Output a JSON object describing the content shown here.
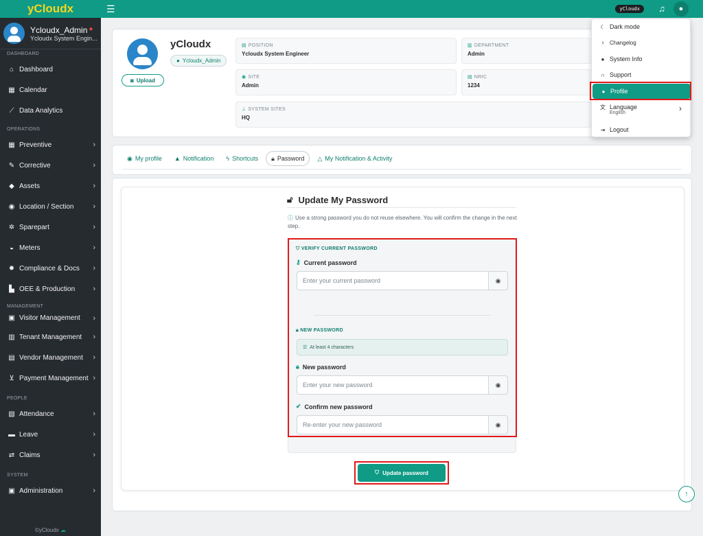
{
  "brand": "yCloudx",
  "user": {
    "name": "Ycloudx_Admin",
    "role": "Ycloudx System Engin..."
  },
  "sidebar": {
    "sections": [
      {
        "label": "DASHBOARD",
        "items": [
          {
            "label": "Dashboard",
            "icon": "home-icon"
          },
          {
            "label": "Calendar",
            "icon": "calendar-icon"
          },
          {
            "label": "Data Analytics",
            "icon": "chart-line-icon"
          }
        ]
      },
      {
        "label": "OPERATIONS",
        "items": [
          {
            "label": "Preventive",
            "icon": "calendar-check-icon"
          },
          {
            "label": "Corrective",
            "icon": "wrench-icon"
          },
          {
            "label": "Assets",
            "icon": "tag-icon"
          },
          {
            "label": "Location / Section",
            "icon": "location-icon"
          },
          {
            "label": "Sparepart",
            "icon": "cogs-icon"
          },
          {
            "label": "Meters",
            "icon": "gauge-icon"
          },
          {
            "label": "Compliance & Docs",
            "icon": "certificate-icon"
          },
          {
            "label": "OEE & Production",
            "icon": "industry-icon"
          }
        ]
      },
      {
        "label": "MANAGEMENT",
        "items": [
          {
            "label": "Visitor Management",
            "icon": "id-badge-icon"
          },
          {
            "label": "Tenant Management",
            "icon": "building-icon"
          },
          {
            "label": "Vendor Management",
            "icon": "id-card-icon"
          },
          {
            "label": "Payment Management",
            "icon": "cart-icon"
          }
        ]
      },
      {
        "label": "PEOPLE",
        "items": [
          {
            "label": "Attendance",
            "icon": "clipboard-icon"
          },
          {
            "label": "Leave",
            "icon": "briefcase-icon"
          },
          {
            "label": "Claims",
            "icon": "exchange-icon"
          }
        ]
      },
      {
        "label": "SYSTEM",
        "items": [
          {
            "label": "Administration",
            "icon": "user-shield-icon"
          }
        ]
      }
    ],
    "footer": "©yCloudx"
  },
  "topbar": {
    "badge": "yCloudx"
  },
  "profile": {
    "name": "yCloudx",
    "username": "Ycloudx_Admin",
    "upload_label": "Upload",
    "fields": [
      {
        "label": "POSITION",
        "value": "Ycloudx System Engineer"
      },
      {
        "label": "DEPARTMENT",
        "value": "Admin"
      },
      {
        "label": "SITE",
        "value": "Admin"
      },
      {
        "label": "NRIC",
        "value": "1234"
      },
      {
        "label": "SYSTEM SITES",
        "value": "HQ"
      }
    ]
  },
  "tabs": [
    {
      "label": "My profile",
      "active": false
    },
    {
      "label": "Notification",
      "active": false
    },
    {
      "label": "Shortcuts",
      "active": false
    },
    {
      "label": "Password",
      "active": true
    },
    {
      "label": "My Notification & Activity",
      "active": false
    }
  ],
  "form": {
    "title": "Update My Password",
    "hint": "Use a strong password you do not reuse elsewhere. You will confirm the change in the next step.",
    "verify_heading": "VERIFY CURRENT PASSWORD",
    "current_label": "Current password",
    "current_placeholder": "Enter your current password",
    "new_heading": "NEW PASSWORD",
    "rule": "At least 4 characters",
    "new_label": "New password",
    "new_placeholder": "Enter your new password",
    "confirm_label": "Confirm new password",
    "confirm_placeholder": "Re-enter your new password",
    "submit_label": "Update password"
  },
  "menu": {
    "dark_mode": "Dark mode",
    "changelog": "Changelog",
    "system_info": "System Info",
    "support": "Support",
    "profile": "Profile",
    "language": "Language",
    "language_value": "English",
    "logout": "Logout"
  },
  "colors": {
    "accent": "#0f9b85",
    "brand_text": "#f6d51e",
    "sidebar": "#262b30",
    "highlight": "#e01818"
  }
}
